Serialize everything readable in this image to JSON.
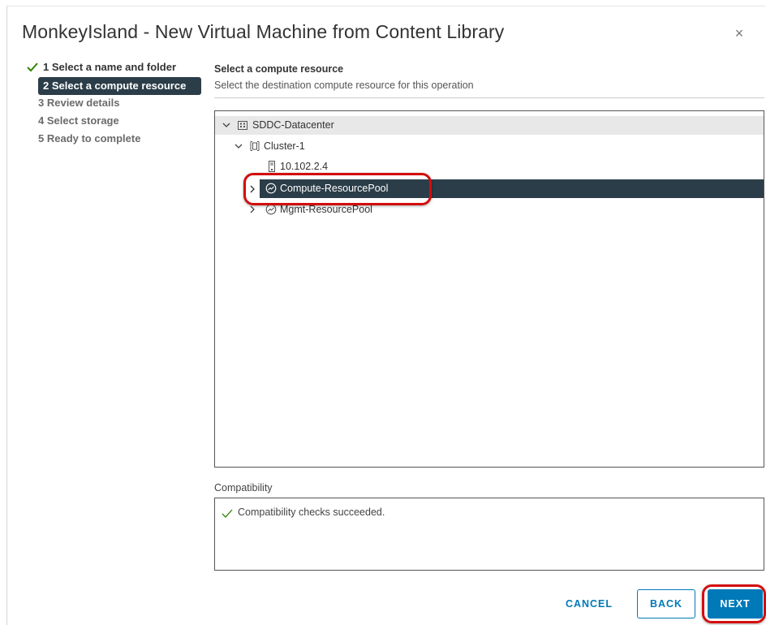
{
  "dialog": {
    "title": "MonkeyIsland - New Virtual Machine from Content Library",
    "close_glyph": "×"
  },
  "steps": [
    {
      "label": "1 Select a name and folder",
      "state": "done"
    },
    {
      "label": "2 Select a compute resource",
      "state": "active"
    },
    {
      "label": "3 Review details",
      "state": "todo"
    },
    {
      "label": "4 Select storage",
      "state": "todo"
    },
    {
      "label": "5 Ready to complete",
      "state": "todo"
    }
  ],
  "main": {
    "section_title": "Select a compute resource",
    "section_desc": "Select the destination compute resource for this operation"
  },
  "tree": {
    "nodes": [
      {
        "label": "SDDC-Datacenter",
        "icon": "datacenter-icon",
        "expanded": true
      },
      {
        "label": "Cluster-1",
        "icon": "cluster-icon",
        "expanded": true
      },
      {
        "label": "10.102.2.4",
        "icon": "host-icon"
      },
      {
        "label": "Compute-ResourcePool",
        "icon": "resource-pool-icon",
        "expanded": false,
        "selected": true
      },
      {
        "label": "Mgmt-ResourcePool",
        "icon": "resource-pool-icon",
        "expanded": false
      }
    ]
  },
  "compatibility": {
    "label": "Compatibility",
    "message": "Compatibility checks succeeded."
  },
  "buttons": {
    "cancel": "CANCEL",
    "back": "BACK",
    "next": "NEXT"
  },
  "colors": {
    "accent": "#0079b8",
    "selected_bg": "#2b3d48",
    "success": "#2f8400",
    "annotation": "#d40d0d"
  }
}
